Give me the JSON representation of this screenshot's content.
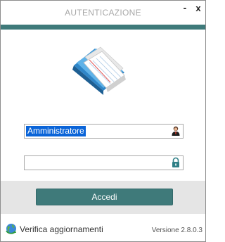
{
  "window": {
    "title": "AUTENTICAZIONE",
    "minimize_label": "-",
    "close_label": "x"
  },
  "login": {
    "username_value": "Amministratore",
    "password_value": "",
    "submit_label": "Accedi",
    "user_icon": "user-avatar-icon",
    "password_icon": "lock-icon"
  },
  "footer": {
    "update_label": "Verifica aggiornamenti",
    "update_icon": "globe-refresh-icon",
    "version_label": "Versione 2.8.0.3"
  },
  "colors": {
    "accent": "#3f7a7a",
    "selection": "#0a64d8",
    "footer_background": "#e5e5e5",
    "title_text": "#a8a8a8"
  }
}
